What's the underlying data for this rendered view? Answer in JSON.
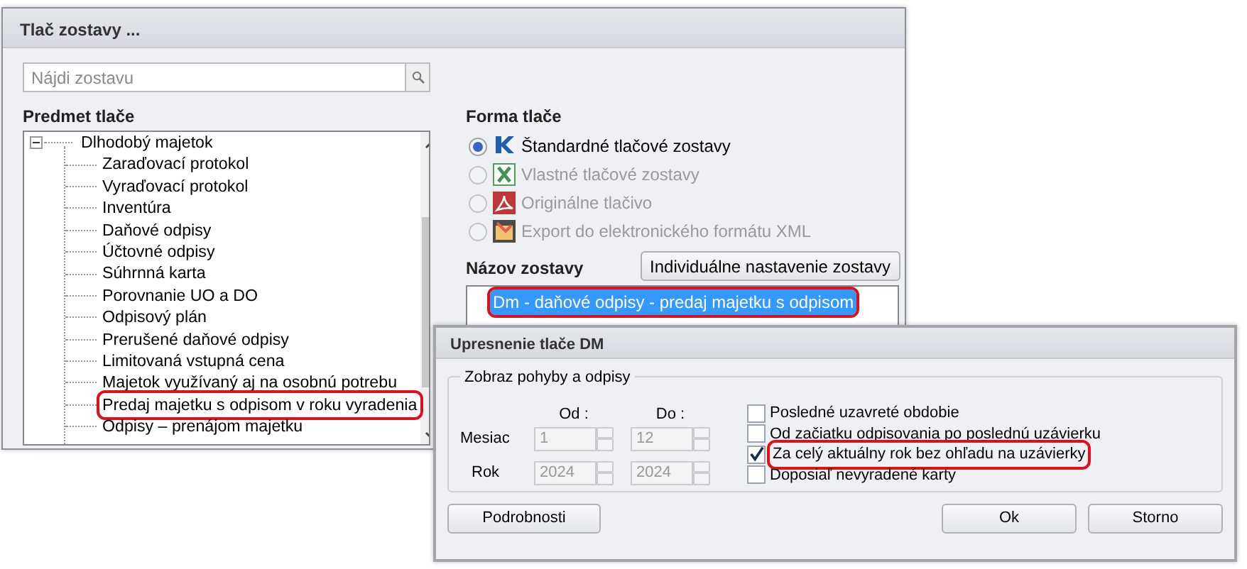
{
  "main_window": {
    "title": "Tlač zostavy ...",
    "search": {
      "placeholder": "Nájdi zostavu"
    },
    "subject": {
      "label": "Predmet tlače",
      "tree": [
        {
          "label": "Dlhodobý majetok",
          "expanded": true,
          "children": [
            {
              "label": "Zaraďovací protokol",
              "highlighted": false
            },
            {
              "label": "Vyraďovací protokol",
              "highlighted": false
            },
            {
              "label": "Inventúra",
              "highlighted": false
            },
            {
              "label": "Daňové odpisy",
              "highlighted": false
            },
            {
              "label": "Účtovné odpisy",
              "highlighted": false
            },
            {
              "label": "Súhrnná karta",
              "highlighted": false
            },
            {
              "label": "Porovnanie UO a DO",
              "highlighted": false
            },
            {
              "label": "Odpisový plán",
              "highlighted": false
            },
            {
              "label": "Prerušené daňové odpisy",
              "highlighted": false
            },
            {
              "label": "Limitovaná vstupná cena",
              "highlighted": false
            },
            {
              "label": "Majetok využívaný aj na osobnú potrebu",
              "highlighted": false
            },
            {
              "label": "Predaj majetku s odpisom v roku vyradenia",
              "highlighted": true
            },
            {
              "label": "Odpisy – prenájom majetku",
              "highlighted": false
            }
          ]
        }
      ]
    },
    "format": {
      "label": "Forma tlače",
      "options": [
        {
          "label": "Štandardné tlačové zostavy",
          "kind": "kros",
          "selected": true,
          "disabled": false
        },
        {
          "label": "Vlastné tlačové zostavy",
          "kind": "excel",
          "selected": false,
          "disabled": true
        },
        {
          "label": "Originálne tlačivo",
          "kind": "pdf",
          "selected": false,
          "disabled": true
        },
        {
          "label": "Export do elektronického formátu XML",
          "kind": "xml",
          "selected": false,
          "disabled": true
        }
      ]
    },
    "report_name": {
      "label": "Názov zostavy",
      "button": "Individuálne nastavenie zostavy",
      "items": [
        {
          "label": "Dm - daňové odpisy - predaj majetku s odpisom",
          "selected": true,
          "highlighted": true
        }
      ]
    }
  },
  "detail_dialog": {
    "title": "Upresnenie tlače DM",
    "group": {
      "legend": "Zobraz pohyby a odpisy",
      "from_label": "Od :",
      "to_label": "Do :",
      "spinners_disabled": true,
      "rows": [
        {
          "label": "Mesiac",
          "from": "1",
          "to": "12"
        },
        {
          "label": "Rok",
          "from": "2024",
          "to": "2024"
        }
      ],
      "options": [
        {
          "label": "Posledné uzavreté obdobie",
          "checked": false,
          "highlighted": false
        },
        {
          "label": "Od začiatku odpisovania po poslednú uzávierku",
          "checked": false,
          "highlighted": false
        },
        {
          "label": "Za celý aktuálny rok bez ohľadu na uzávierky",
          "checked": true,
          "highlighted": true
        },
        {
          "label": "Doposiaľ nevyradené karty",
          "checked": false,
          "highlighted": false
        }
      ]
    },
    "buttons": [
      "Podrobnosti",
      "Ok",
      "Storno"
    ]
  }
}
